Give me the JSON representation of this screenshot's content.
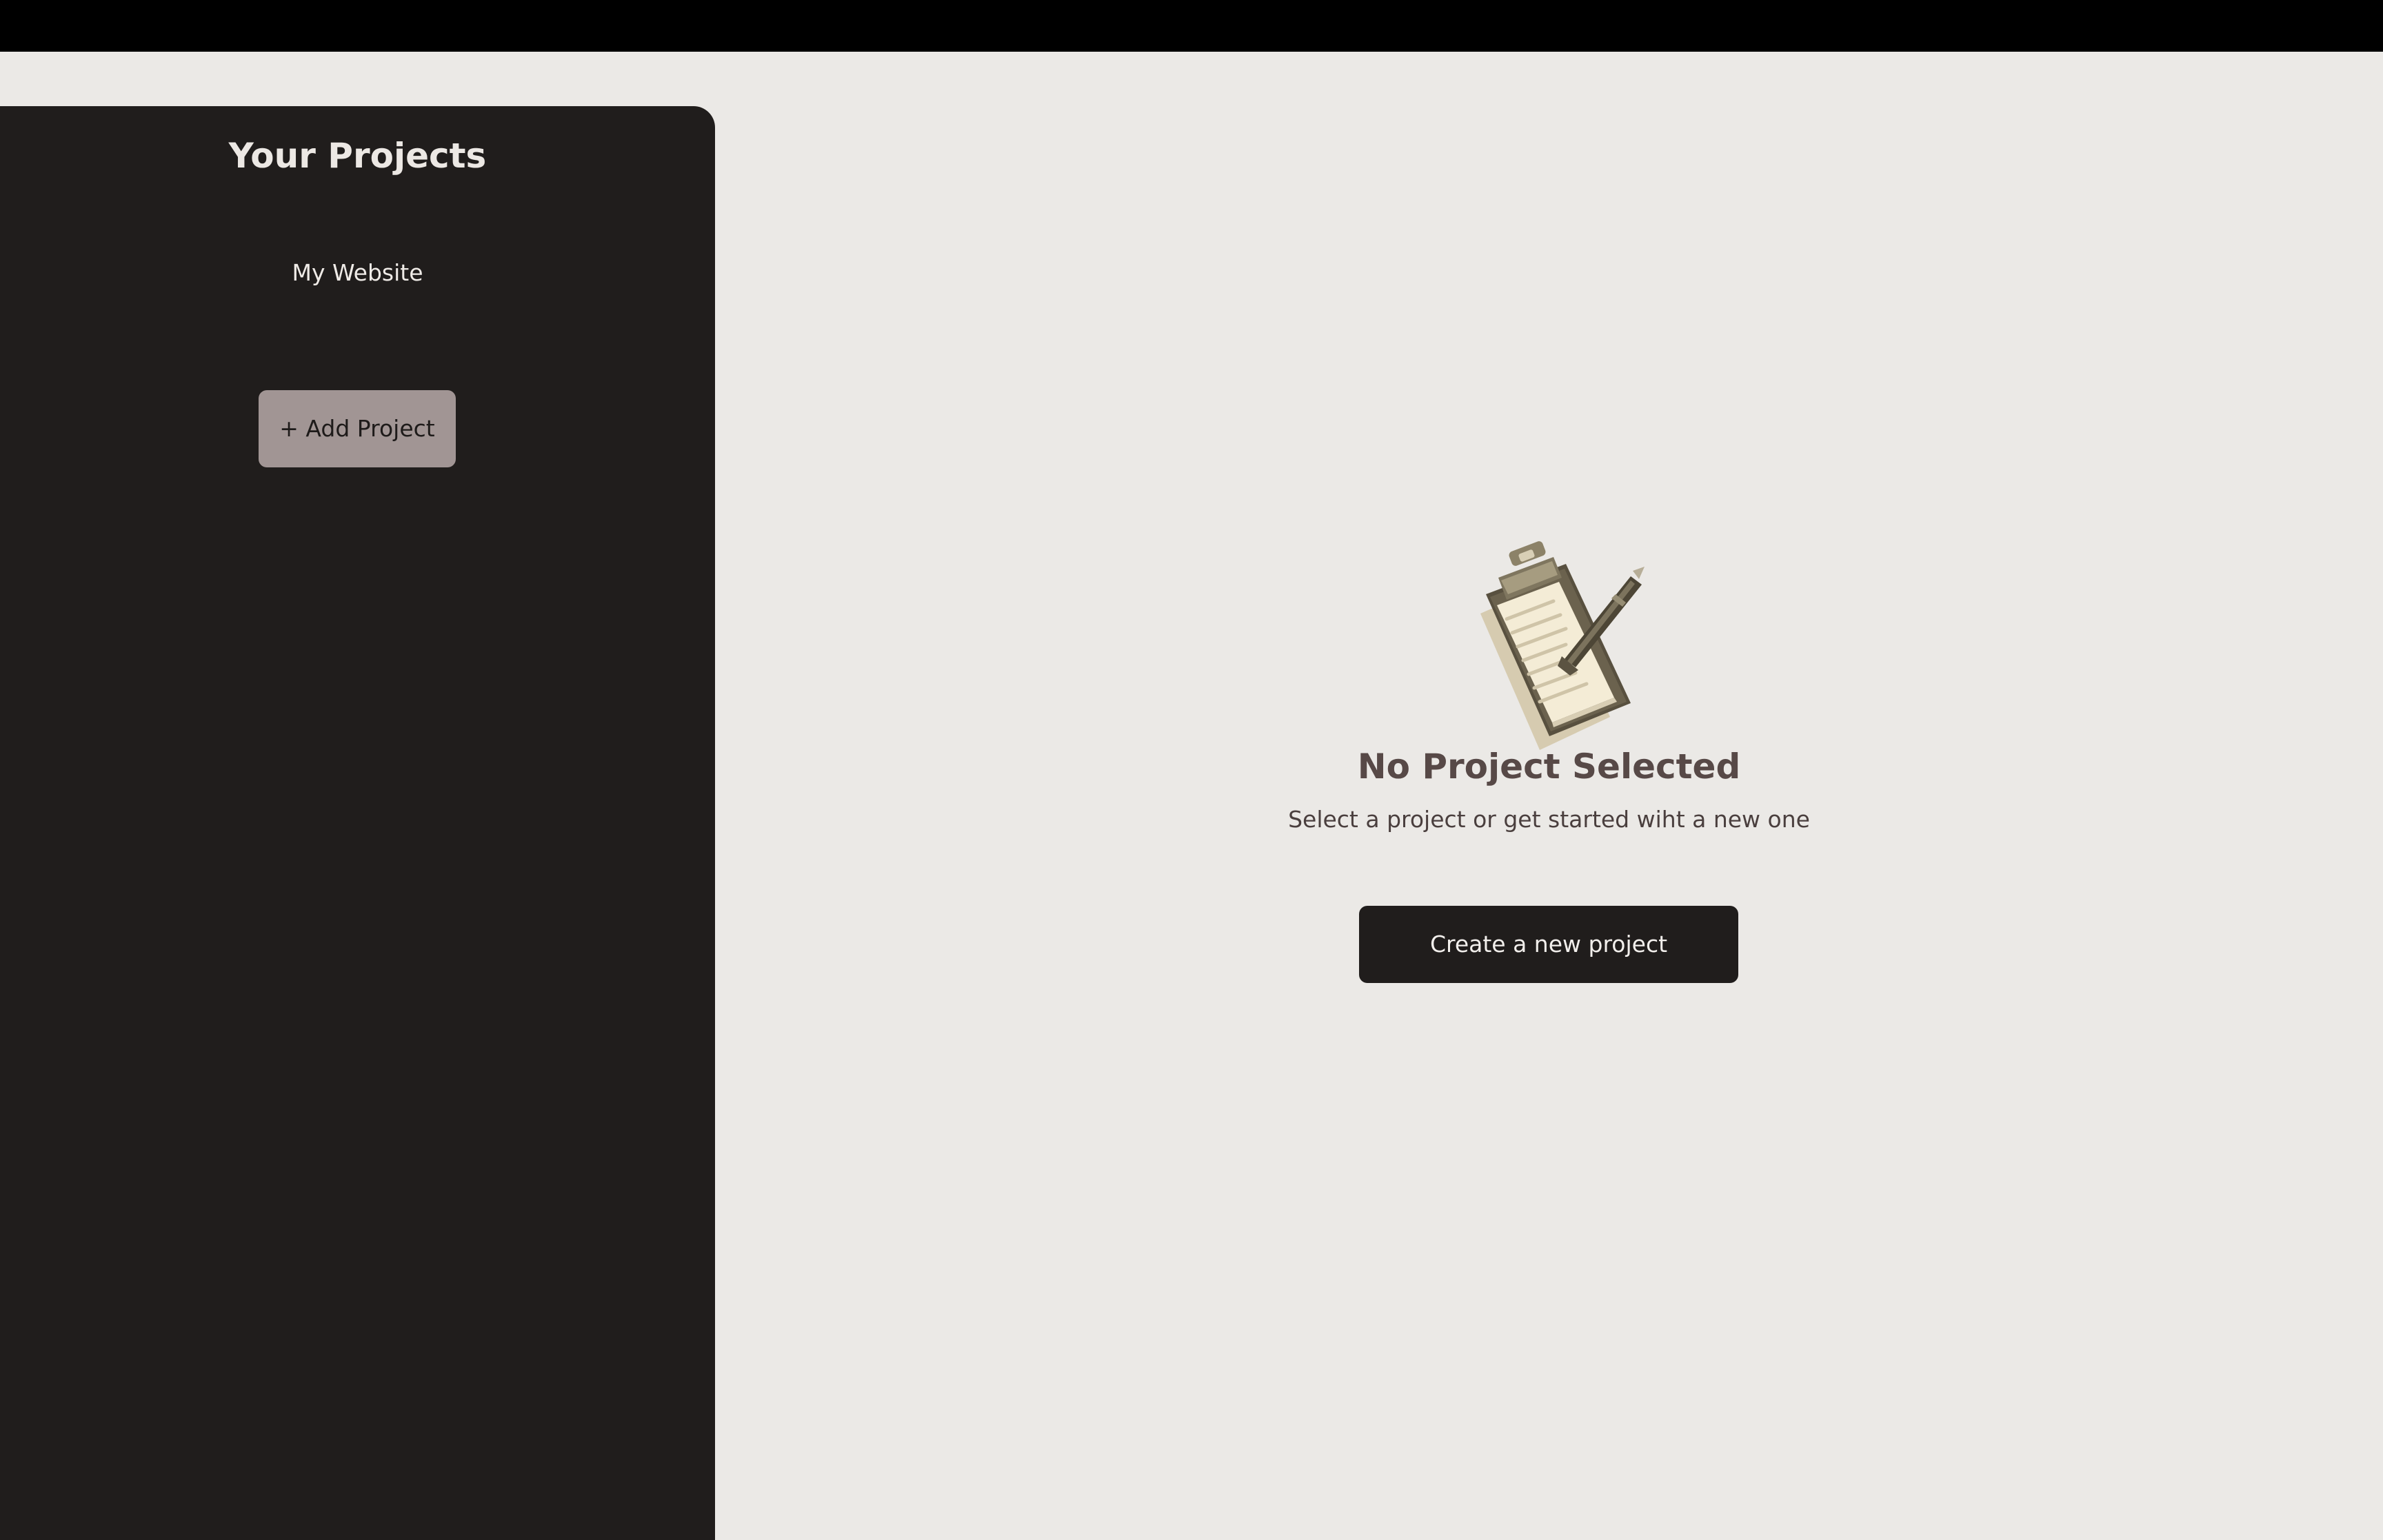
{
  "sidebar": {
    "title": "Your Projects",
    "projects": [
      {
        "label": "My Website"
      }
    ],
    "add_button_label": "+ Add Project"
  },
  "main": {
    "illustration_icon": "clipboard-with-pen-icon",
    "empty_title": "No Project Selected",
    "empty_subtitle": "Select a project or get started wiht a new one",
    "create_button_label": "Create a new project"
  },
  "colors": {
    "top_bar": "#000000",
    "page_background": "#ebe9e6",
    "sidebar_background": "#201d1c",
    "add_button_background": "#a19594",
    "create_button_background": "#201d1c",
    "empty_title": "#574947"
  }
}
